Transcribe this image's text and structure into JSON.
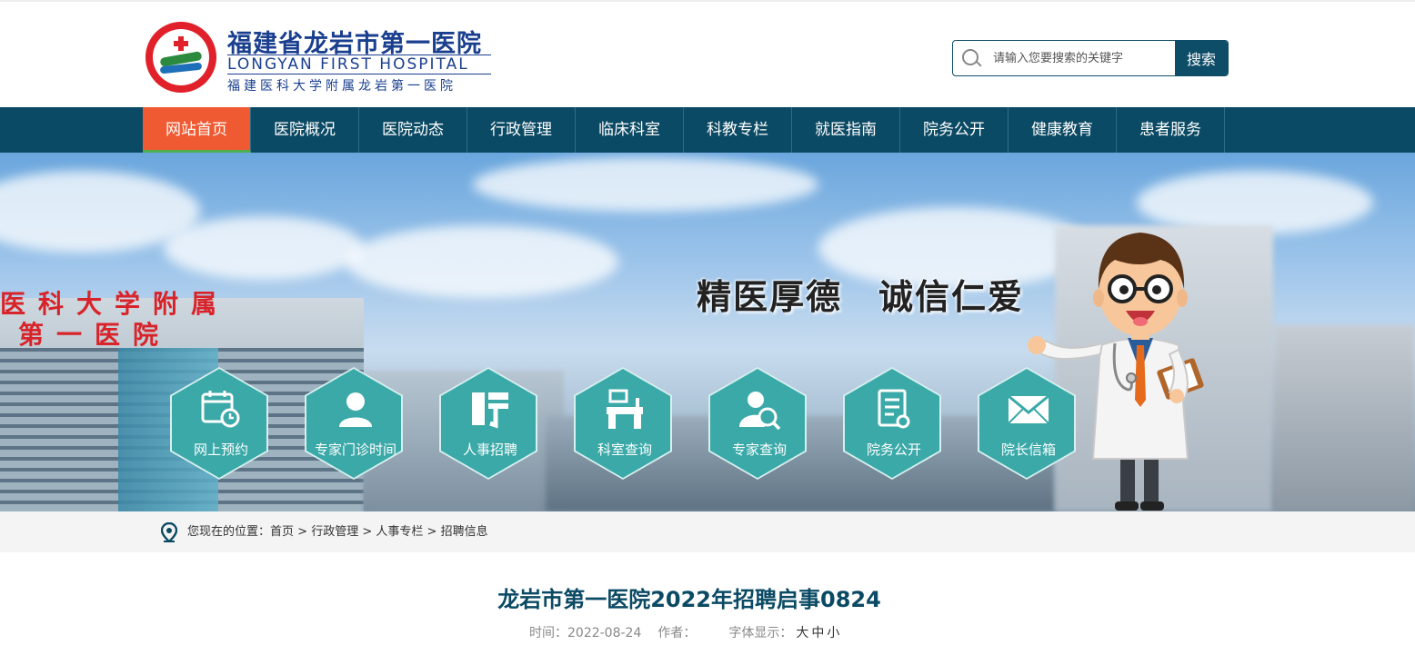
{
  "header": {
    "logo_cn": "福建省龙岩市第一医院",
    "logo_en": "LONGYAN FIRST HOSPITAL",
    "logo_sub": "福建医科大学附属龙岩第一医院",
    "search_placeholder": "请输入您要搜索的关键字",
    "search_button": "搜索"
  },
  "nav": {
    "items": [
      {
        "label": "网站首页",
        "active": true
      },
      {
        "label": "医院概况"
      },
      {
        "label": "医院动态"
      },
      {
        "label": "行政管理"
      },
      {
        "label": "临床科室"
      },
      {
        "label": "科教专栏"
      },
      {
        "label": "就医指南"
      },
      {
        "label": "院务公开"
      },
      {
        "label": "健康教育"
      },
      {
        "label": "患者服务"
      }
    ]
  },
  "banner": {
    "slogan": "精医厚德　诚信仁爱",
    "building_text_1": "医科大学附属",
    "building_text_2": "第一医院",
    "quick_links": [
      {
        "label": "网上预约",
        "icon": "calendar-clock-icon"
      },
      {
        "label": "专家门诊时间",
        "icon": "user-icon"
      },
      {
        "label": "人事招聘",
        "icon": "recruit-icon"
      },
      {
        "label": "科室查询",
        "icon": "desk-icon"
      },
      {
        "label": "专家查询",
        "icon": "user-search-icon"
      },
      {
        "label": "院务公开",
        "icon": "document-icon"
      },
      {
        "label": "院长信箱",
        "icon": "mail-icon"
      }
    ]
  },
  "breadcrumb": {
    "prefix": "您现在的位置：",
    "items": [
      "首页",
      "行政管理",
      "人事专栏",
      "招聘信息"
    ],
    "separator": " > "
  },
  "article": {
    "title": "龙岩市第一医院2022年招聘启事0824",
    "time_label": "时间：",
    "time_value": "2022-08-24",
    "author_label": "作者：",
    "font_label": "字体显示：",
    "font_sizes": [
      "大",
      "中",
      "小"
    ]
  },
  "colors": {
    "nav_bg": "#0b4a64",
    "nav_active": "#ef5a32",
    "hex_teal": "#3aa9a8",
    "title_color": "#0b4a64"
  }
}
